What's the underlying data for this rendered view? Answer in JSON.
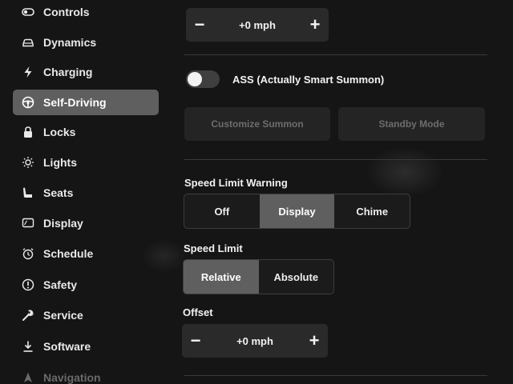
{
  "sidebar": {
    "items": [
      {
        "label": "Controls",
        "icon": "toggle-icon"
      },
      {
        "label": "Dynamics",
        "icon": "car-icon"
      },
      {
        "label": "Charging",
        "icon": "lightning-icon"
      },
      {
        "label": "Self-Driving",
        "icon": "steering-wheel-icon"
      },
      {
        "label": "Locks",
        "icon": "lock-icon"
      },
      {
        "label": "Lights",
        "icon": "sun-icon"
      },
      {
        "label": "Seats",
        "icon": "seat-icon"
      },
      {
        "label": "Display",
        "icon": "display-icon"
      },
      {
        "label": "Schedule",
        "icon": "alarm-clock-icon"
      },
      {
        "label": "Safety",
        "icon": "alert-circle-icon"
      },
      {
        "label": "Service",
        "icon": "wrench-icon"
      },
      {
        "label": "Software",
        "icon": "download-icon"
      },
      {
        "label": "Navigation",
        "icon": "navigation-arrow-icon"
      }
    ],
    "active": "Self-Driving"
  },
  "content": {
    "top_stepper": {
      "value": "+0 mph",
      "minus": "−",
      "plus": "+"
    },
    "smart_summon": {
      "label": "ASS (Actually Smart Summon)",
      "enabled": false
    },
    "customize_summon": "Customize Summon",
    "standby_mode": "Standby Mode",
    "speed_limit_warning": {
      "label": "Speed Limit Warning",
      "options": [
        "Off",
        "Display",
        "Chime"
      ],
      "selected": "Display"
    },
    "speed_limit": {
      "label": "Speed Limit",
      "options": [
        "Relative",
        "Absolute"
      ],
      "selected": "Relative"
    },
    "offset": {
      "label": "Offset",
      "value": "+0 mph",
      "minus": "−",
      "plus": "+"
    }
  },
  "colors": {
    "background": "#151515",
    "selected": "#5f5f5f",
    "panel": "#2a2a2a"
  }
}
